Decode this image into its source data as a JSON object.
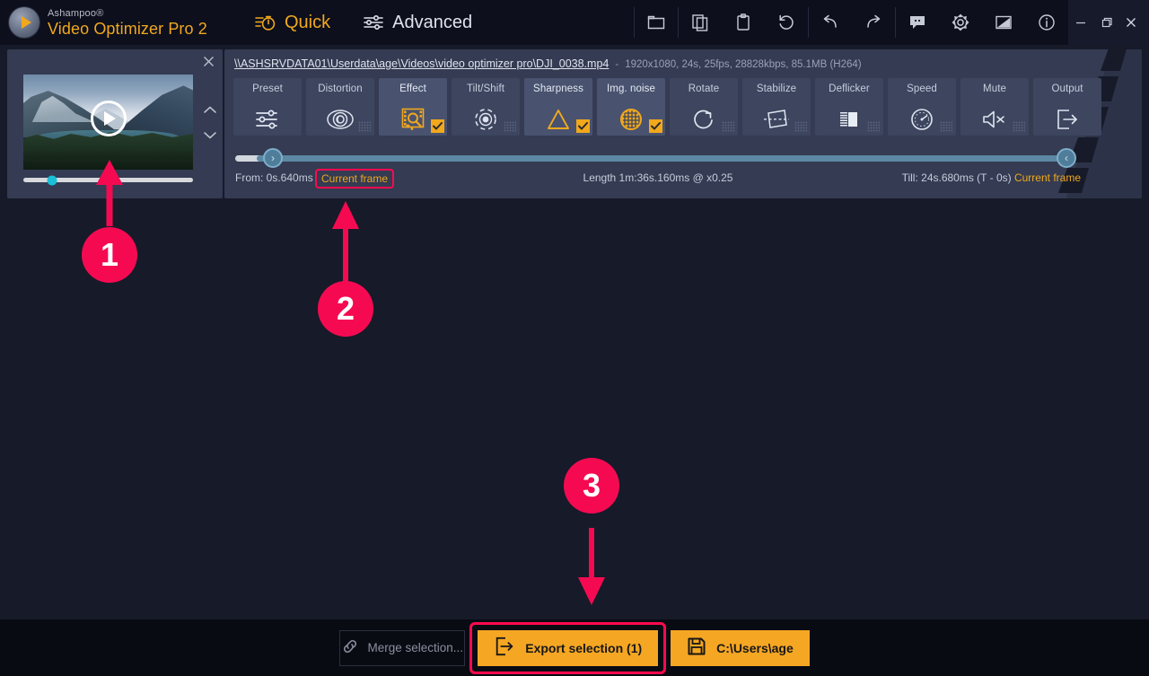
{
  "app": {
    "brand_line1": "Ashampoo®",
    "brand_line2": "Video Optimizer Pro 2",
    "accent_orange": "#f0a81e",
    "panel_bg": "#343b52",
    "window_bg": "#171a29",
    "annotation_pink": "#f50a52"
  },
  "titlebar": {
    "modes": [
      {
        "label": "Quick",
        "icon": "stopwatch-icon",
        "active": true
      },
      {
        "label": "Advanced",
        "icon": "sliders-icon",
        "active": false
      }
    ],
    "tools": [
      {
        "name": "open-folder-icon",
        "title": "Open"
      },
      {
        "name": "copy-icon",
        "title": "Copy"
      },
      {
        "name": "clipboard-icon",
        "title": "Paste"
      },
      {
        "name": "reset-icon",
        "title": "Reset"
      },
      {
        "name": "undo-icon",
        "title": "Undo"
      },
      {
        "name": "redo-icon",
        "title": "Redo"
      },
      {
        "name": "feedback-icon",
        "title": "Feedback"
      },
      {
        "name": "settings-gear-icon",
        "title": "Settings"
      },
      {
        "name": "theme-icon",
        "title": "Theme"
      },
      {
        "name": "info-icon",
        "title": "Info"
      }
    ],
    "window_controls": [
      {
        "name": "minimize-button",
        "glyph": "─"
      },
      {
        "name": "maximize-button",
        "glyph": "❐"
      },
      {
        "name": "close-button",
        "glyph": "✕"
      }
    ]
  },
  "video_panel": {
    "close_label": "✕",
    "play_label": "Play",
    "seek_position_percent": 17,
    "nav_up": "chevron-up-icon",
    "nav_down": "chevron-down-icon"
  },
  "edit_panel": {
    "file_path": "\\\\ASHSRVDATA01\\Userdata\\age\\Videos\\video optimizer pro\\DJI_0038.mp4",
    "dash": "-",
    "file_info": "1920x1080, 24s, 25fps, 28828kbps, 85.1MB (H264)",
    "tools": [
      {
        "label": "Preset",
        "icon": "sliders-icon",
        "checked": false,
        "active": false,
        "dots": false
      },
      {
        "label": "Distortion",
        "icon": "lens-eye-icon",
        "checked": false,
        "active": false,
        "dots": true
      },
      {
        "label": "Effect",
        "icon": "film-search-icon",
        "checked": true,
        "active": true,
        "dots": false
      },
      {
        "label": "Tilt/Shift",
        "icon": "focus-dot-icon",
        "checked": false,
        "active": false,
        "dots": true
      },
      {
        "label": "Sharpness",
        "icon": "triangle-icon",
        "checked": true,
        "active": true,
        "dots": false
      },
      {
        "label": "Img. noise",
        "icon": "grid-circle-icon",
        "checked": true,
        "active": true,
        "dots": false
      },
      {
        "label": "Rotate",
        "icon": "rotate-icon",
        "checked": false,
        "active": false,
        "dots": true
      },
      {
        "label": "Stabilize",
        "icon": "stabilize-icon",
        "checked": false,
        "active": false,
        "dots": true
      },
      {
        "label": "Deflicker",
        "icon": "deflicker-icon",
        "checked": false,
        "active": false,
        "dots": true
      },
      {
        "label": "Speed",
        "icon": "speedometer-icon",
        "checked": false,
        "active": false,
        "dots": true
      },
      {
        "label": "Mute",
        "icon": "mute-icon",
        "checked": false,
        "active": false,
        "dots": true
      },
      {
        "label": "Output",
        "icon": "export-icon",
        "checked": false,
        "active": false,
        "dots": false
      }
    ],
    "timeline": {
      "from_label": "From:  0s.640ms",
      "from_current_frame": "Current frame",
      "length_label": "Length 1m:36s.160ms @ x0.25",
      "till_label": "Till: 24s.680ms (T - 0s)",
      "till_current_frame": "Current frame",
      "left_handle_pos_percent": 2,
      "right_handle_pos_percent": 98
    }
  },
  "bottom_bar": {
    "merge_label": "Merge selection...",
    "merge_icon": "link-icon",
    "export_label": "Export selection (1)",
    "export_icon": "export-icon",
    "save_label": "C:\\Users\\age",
    "save_icon": "floppy-disk-icon"
  },
  "annotations": [
    {
      "number": "1",
      "target": "video-preview-seek-bar"
    },
    {
      "number": "2",
      "target": "from-current-frame-button"
    },
    {
      "number": "3",
      "target": "export-selection-button"
    }
  ]
}
